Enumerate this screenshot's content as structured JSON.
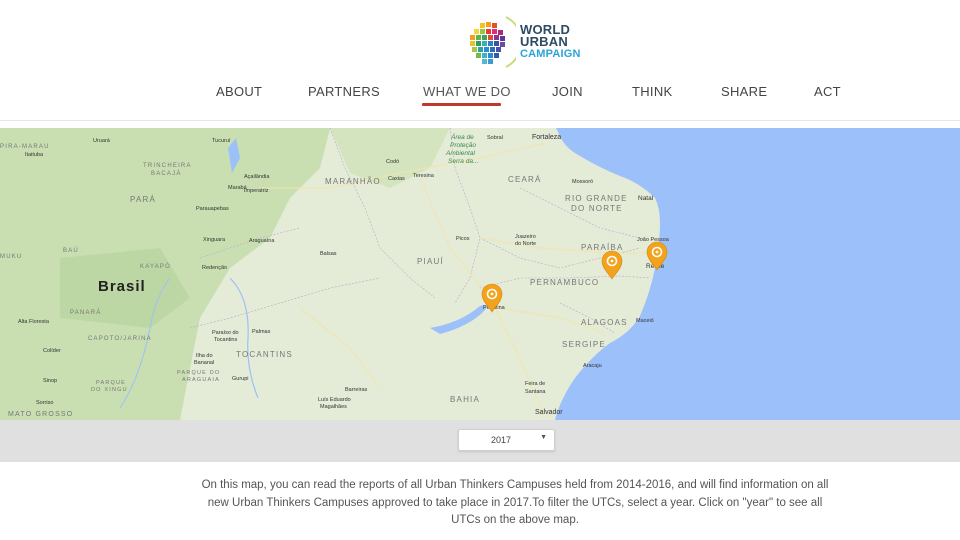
{
  "brand": {
    "line1": "WORLD",
    "line2": "URBAN",
    "line3": "CAMPAIGN"
  },
  "nav": {
    "items": [
      {
        "label": "ABOUT"
      },
      {
        "label": "PARTNERS"
      },
      {
        "label": "WHAT WE DO",
        "active": true
      },
      {
        "label": "JOIN"
      },
      {
        "label": "THINK"
      },
      {
        "label": "SHARE"
      },
      {
        "label": "ACT"
      }
    ]
  },
  "map": {
    "country": "Brasil",
    "states": [
      "PARÁ",
      "MARANHÃO",
      "PIAUÍ",
      "CEARÁ",
      "RIO GRANDE",
      "DO NORTE",
      "PARAÍBA",
      "PERNAMBUCO",
      "ALAGOAS",
      "SERGIPE",
      "BAHIA",
      "TOCANTINS",
      "KAYAPÓ",
      "PANARÁ",
      "TRINCHEIRA",
      "BACAJÁ",
      "CAPOTO/JARINA",
      "PARQUE DO",
      "ARAGUAIA",
      "PARQUE",
      "DO XINGU",
      "MATO GROSSO",
      "BAÚ",
      "MUKU",
      "PIRA-MARAU"
    ],
    "cities": [
      "Fortaleza",
      "Sobral",
      "Mossoró",
      "Natal",
      "João Pessoa",
      "Recife",
      "Maceió",
      "Aracaju",
      "Salvador",
      "Feira de",
      "Santana",
      "Teresina",
      "Caxias",
      "Codó",
      "Imperatriz",
      "Marabá",
      "Açailândia",
      "Parauapebas",
      "Xinguara",
      "Araguaína",
      "Balsas",
      "Redenção",
      "Picos",
      "Juazeiro",
      "do Norte",
      "Petrolina",
      "Barreiras",
      "Luís Eduardo",
      "Magalhães",
      "Palmas",
      "Paraíso do",
      "Tocantins",
      "Ilha do",
      "Bananal",
      "Gurupi",
      "Colíder",
      "Sinop",
      "Sorriso",
      "Alta Floresta",
      "Tucuruí",
      "Uruará",
      "Itaituba"
    ],
    "park_label": [
      "Área de",
      "Proteção",
      "Ambiental",
      "Serra da..."
    ],
    "pins": [
      {
        "name": "Petrolina"
      },
      {
        "name": "Campina Grande"
      },
      {
        "name": "Recife"
      }
    ],
    "colors": {
      "ocean": "#9cc0f9",
      "land": "#e4ebd7",
      "forest": "#c8dfb0",
      "pin": "#f2a21b"
    }
  },
  "filter": {
    "year_value": "2017"
  },
  "description": "On this map, you can read the reports of all Urban Thinkers Campuses held from 2014-2016, and will find information on all new Urban Thinkers Campuses approved to take place in 2017.To filter the UTCs, select a year. Click on \"year\" to see all UTCs on the above map."
}
